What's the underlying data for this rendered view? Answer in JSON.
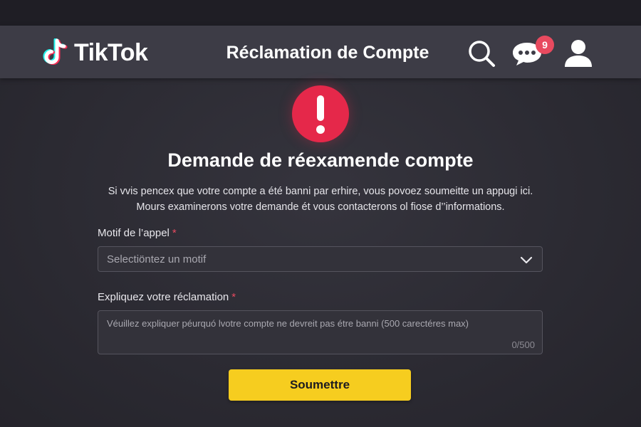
{
  "header": {
    "brand": "TikTok",
    "title": "Réclamation de Compte",
    "notifications_count": "9",
    "icons": {
      "logo": "tiktok-note-icon",
      "search": "search-icon",
      "messages": "chat-bubble-icon",
      "profile": "user-icon"
    }
  },
  "alert": {
    "icon": "exclamation-icon",
    "color": "#e5284a"
  },
  "main": {
    "title": "Demande de réexamende compte",
    "description_line1": "Si vvis pencex que votre compte a été banni par erhire, vous povoez soumeitte un appugi ici.",
    "description_line2": "Mours examinerons votre demande ét vous contacterons ol fiose d’’informations."
  },
  "form": {
    "reason_label": "Motif de l’appel",
    "reason_required": "*",
    "reason_placeholder": "Selectiöntez un motif",
    "explain_label": "Expliquez votre réclamation",
    "explain_required": "*",
    "explain_placeholder": "Véuillez expliquer péurquó lvotre compte ne devreit pas étre banni (500 carectéres max)",
    "char_counter": "0/500",
    "submit_label": "Soumettre"
  },
  "colors": {
    "accent_button": "#f6cd1f",
    "alert_red": "#e5284a",
    "badge_red": "#e84a5f",
    "header_bg": "#3d3c46",
    "page_bg": "#2c2b33"
  }
}
